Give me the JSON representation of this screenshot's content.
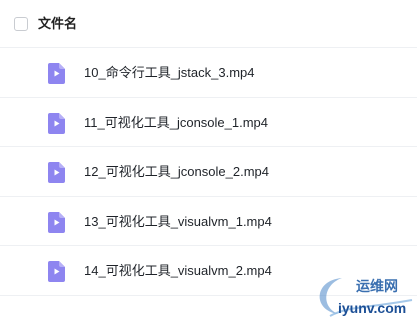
{
  "header": {
    "column_label": "文件名"
  },
  "files": [
    {
      "name": "10_命令行工具_jstack_3.mp4",
      "icon": "video-file-icon"
    },
    {
      "name": "11_可视化工具_jconsole_1.mp4",
      "icon": "video-file-icon"
    },
    {
      "name": "12_可视化工具_jconsole_2.mp4",
      "icon": "video-file-icon"
    },
    {
      "name": "13_可视化工具_visualvm_1.mp4",
      "icon": "video-file-icon"
    },
    {
      "name": "14_可视化工具_visualvm_2.mp4",
      "icon": "video-file-icon"
    }
  ],
  "watermark": {
    "cn": "运维网",
    "en": "iyunv.com"
  },
  "colors": {
    "icon": "#8e85f0",
    "divider": "#eef0f3"
  }
}
